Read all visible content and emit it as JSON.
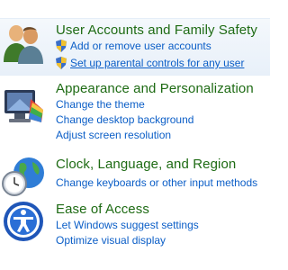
{
  "categories": [
    {
      "title": "User Accounts and Family Safety",
      "icon": "users-icon",
      "links": [
        {
          "label": "Add or remove user accounts",
          "shield": true,
          "underline": false
        },
        {
          "label": "Set up parental controls for any user",
          "shield": true,
          "underline": true
        }
      ]
    },
    {
      "title": "Appearance and Personalization",
      "icon": "appearance-monitor-icon",
      "links": [
        {
          "label": "Change the theme"
        },
        {
          "label": "Change desktop background"
        },
        {
          "label": "Adjust screen resolution"
        }
      ]
    },
    {
      "title": "Clock, Language, and Region",
      "icon": "clock-globe-icon",
      "links": [
        {
          "label": "Change keyboards or other input methods"
        }
      ]
    },
    {
      "title": "Ease of Access",
      "icon": "ease-of-access-icon",
      "links": [
        {
          "label": "Let Windows suggest settings"
        },
        {
          "label": "Optimize visual display"
        }
      ]
    }
  ],
  "colors": {
    "title": "#1e6b14",
    "link": "#0b5ec7",
    "highlight": "#e8f0f9"
  }
}
